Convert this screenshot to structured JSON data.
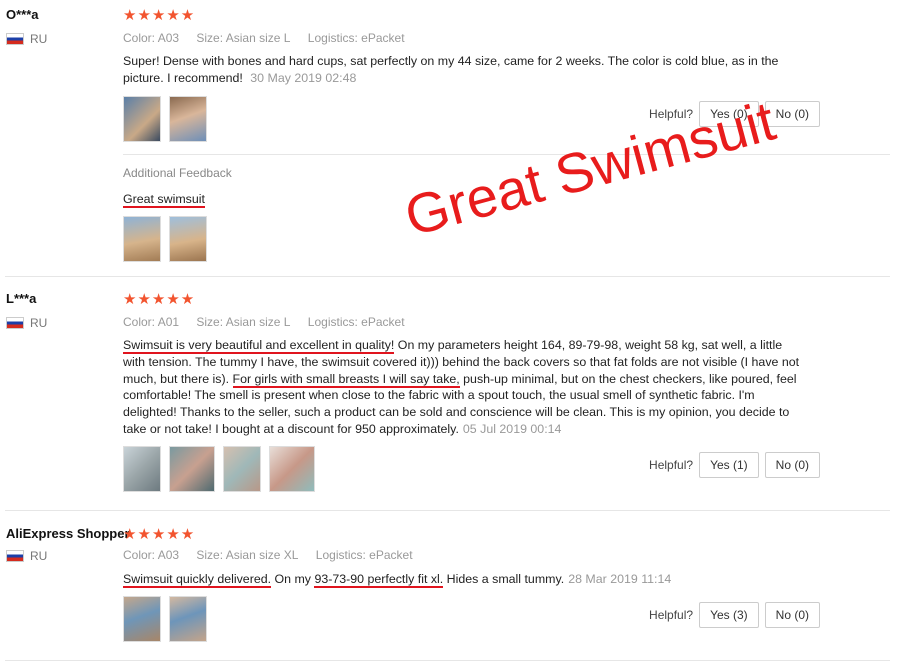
{
  "helpful_label": "Helpful?",
  "overlay": {
    "text": "Great Swimsuit"
  },
  "reviews": [
    {
      "user": "O***a",
      "country": "RU",
      "stars": "★★★★★",
      "color_label": "Color:",
      "color": "A03",
      "size_label": "Size:",
      "size": "Asian size L",
      "logistics_label": "Logistics:",
      "logistics": "ePacket",
      "text": "Super! Dense with bones and hard cups, sat perfectly on my 44 size, came for 2 weeks. The color is cold blue, as in the picture. I recommend!",
      "date": "30 May 2019 02:48",
      "yes": "Yes (0)",
      "no": "No (0)",
      "additional_title": "Additional Feedback",
      "additional_text": "Great swimsuit"
    },
    {
      "user": "L***a",
      "country": "RU",
      "stars": "★★★★★",
      "color_label": "Color:",
      "color": "A01",
      "size_label": "Size:",
      "size": "Asian size L",
      "logistics_label": "Logistics:",
      "logistics": "ePacket",
      "text_parts": [
        "Swimsuit is very beautiful and excellent in quality!",
        " On my parameters height 164, 89-79-98, weight 58 kg, sat well, a little with tension. The tummy I have, the swimsuit covered it))) behind the back covers so that fat folds are not visible (I have not much, but there is). ",
        "For girls with small breasts I will say take,",
        " push-up minimal, but on the chest checkers, like poured, feel comfortable! The smell is present when close to the fabric with a spout touch, the usual smell of synthetic fabric. I'm delighted! Thanks to the seller, such a product can be sold and conscience will be clean. This is my opinion, you decide to take or not take! I bought at a discount for 950 approximately."
      ],
      "date": "05 Jul 2019 00:14",
      "yes": "Yes (1)",
      "no": "No (0)"
    },
    {
      "user": "AliExpress Shopper",
      "country": "RU",
      "stars": "★★★★★",
      "color_label": "Color:",
      "color": "A03",
      "size_label": "Size:",
      "size": "Asian size XL",
      "logistics_label": "Logistics:",
      "logistics": "ePacket",
      "text_parts": [
        "Swimsuit quickly delivered.",
        " On my ",
        "93-73-90 perfectly fit xl.",
        " Hides a small tummy."
      ],
      "date": "28 Mar 2019 11:14",
      "yes": "Yes (3)",
      "no": "No (0)"
    }
  ]
}
